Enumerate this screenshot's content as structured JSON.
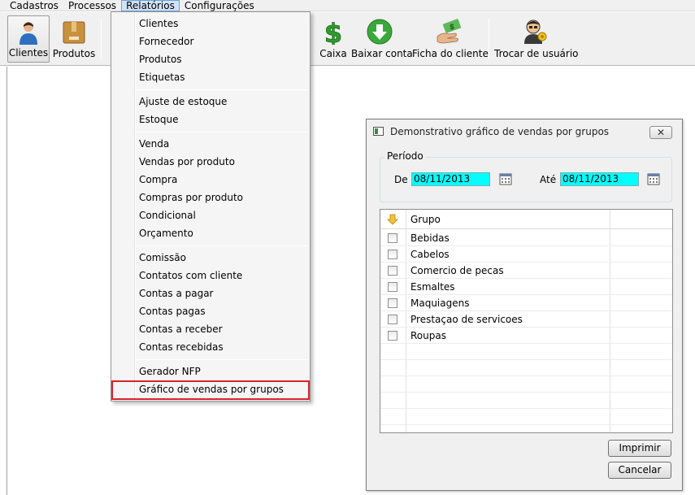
{
  "menubar": {
    "items": [
      "Cadastros",
      "Processos",
      "Relatórios",
      "Configurações"
    ]
  },
  "toolbar": {
    "buttons": [
      "Clientes",
      "Produtos",
      "Caixa",
      "Baixar conta",
      "Ficha do cliente",
      "Trocar de usuário"
    ]
  },
  "reports_menu": {
    "items": [
      "Clientes",
      "Fornecedor",
      "Produtos",
      "Etiquetas",
      "Ajuste de estoque",
      "Estoque",
      "Venda",
      "Vendas por produto",
      "Compra",
      "Compras por produto",
      "Condicional",
      "Orçamento",
      "Comissão",
      "Contatos com cliente",
      "Contas a pagar",
      "Contas pagas",
      "Contas a receber",
      "Contas recebidas",
      "Gerador NFP",
      "Gráfico de vendas por grupos"
    ]
  },
  "dialog": {
    "title": "Demonstrativo gráfico de vendas por grupos",
    "close_label": "✕",
    "period_label": "Período",
    "from_label": "De",
    "from_value": "08/11/2013",
    "to_label": "Até",
    "to_value": "08/11/2013",
    "grid_header": "Grupo",
    "groups": [
      "Bebidas",
      "Cabelos",
      "Comercio de pecas",
      "Esmaltes",
      "Maquiagens",
      "Prestaçao de servicoes",
      "Roupas"
    ],
    "print_label": "Imprimir",
    "cancel_label": "Cancelar"
  },
  "colors": {
    "highlight": "#d9232d",
    "date_field": "#00ffff",
    "menu_open": "#cfe3f7"
  }
}
